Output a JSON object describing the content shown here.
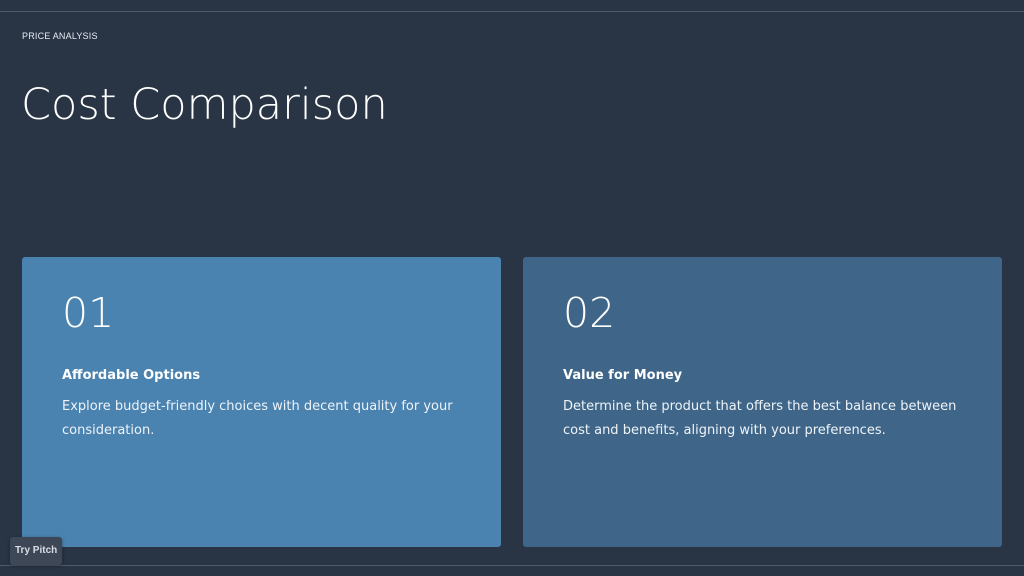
{
  "slide": {
    "eyebrow": "PRICE ANALYSIS",
    "title": "Cost Comparison"
  },
  "cards": [
    {
      "number": "01",
      "heading": "Affordable Options",
      "description": "Explore budget-friendly choices with decent quality for your consideration.",
      "color": "#4a82b0"
    },
    {
      "number": "02",
      "heading": "Value for Money",
      "description": "Determine the product that offers the best balance between cost and benefits, aligning with your preferences.",
      "color": "#3f6689"
    }
  ],
  "badge": {
    "label": "Try Pitch"
  },
  "colors": {
    "background": "#293445",
    "rule": "#4d5a6d"
  }
}
